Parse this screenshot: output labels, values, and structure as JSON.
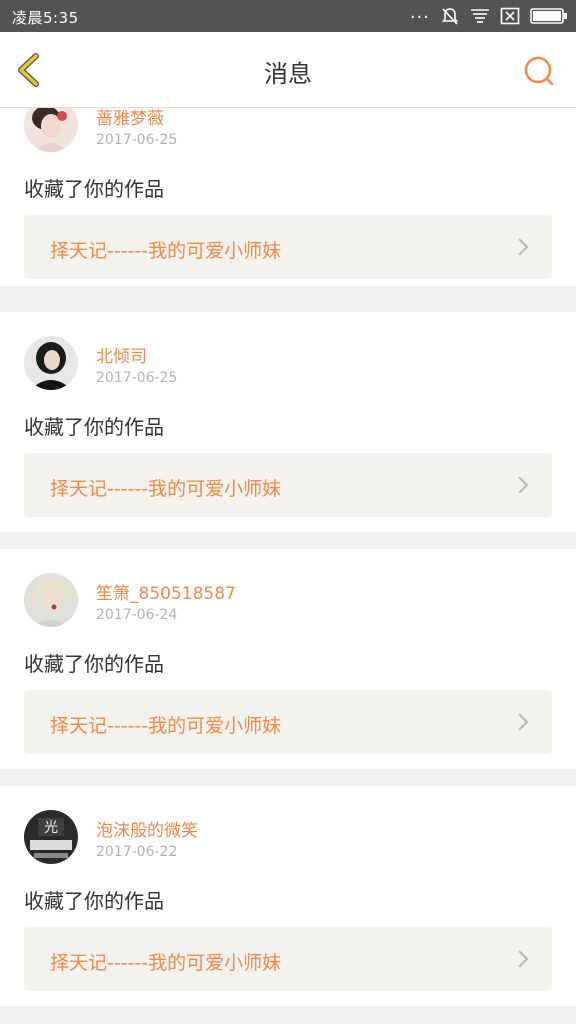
{
  "status_bar": {
    "time": "凌晨5:35",
    "dots": "..."
  },
  "header": {
    "title": "消息"
  },
  "icons": {
    "back": "chevron-left-icon",
    "search": "search-icon",
    "chevron": "chevron-right-icon",
    "mute": "bell-off-icon",
    "notifications": "notification-lines-icon",
    "sim": "sim-card-icon",
    "battery": "battery-icon"
  },
  "colors": {
    "accent": "#ef8a4a",
    "back_icon": "#f2c232",
    "card_bg": "#f3f2ed",
    "page_bg": "#f2f1ef"
  },
  "messages": [
    {
      "user": "蔷雅梦薇",
      "date": "2017-06-25",
      "action": "收藏了你的作品",
      "work": "择天记------我的可爱小师妹"
    },
    {
      "user": "北倾司",
      "date": "2017-06-25",
      "action": "收藏了你的作品",
      "work": "择天记------我的可爱小师妹"
    },
    {
      "user": "笙箫_850518587",
      "date": "2017-06-24",
      "action": "收藏了你的作品",
      "work": "择天记------我的可爱小师妹"
    },
    {
      "user": "泡沫般的微笑",
      "date": "2017-06-22",
      "action": "收藏了你的作品",
      "work": "择天记------我的可爱小师妹"
    }
  ]
}
